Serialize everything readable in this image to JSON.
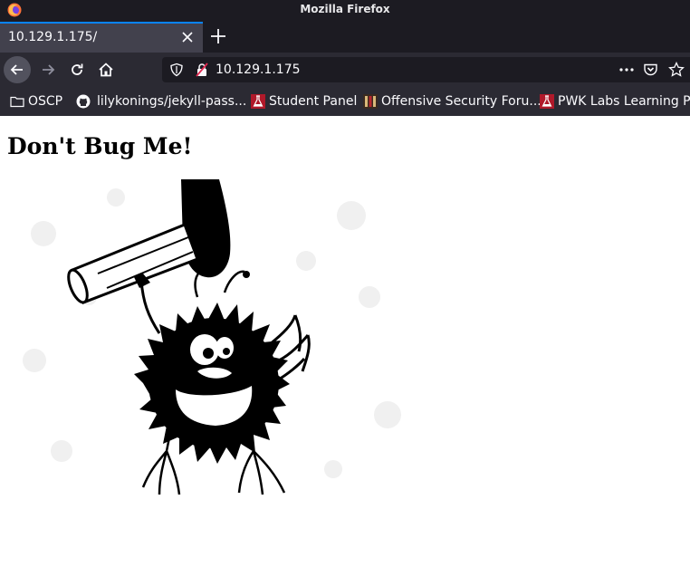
{
  "window": {
    "title": "Mozilla Firefox"
  },
  "tab": {
    "label": "10.129.1.175/"
  },
  "navbar": {
    "url": "10.129.1.175"
  },
  "bookmarks": [
    {
      "label": "OSCP",
      "icon": "folder-icon"
    },
    {
      "label": "lilykonings/jekyll-pass...",
      "icon": "github-icon"
    },
    {
      "label": "Student Panel",
      "icon": "flask-icon"
    },
    {
      "label": "Offensive Security Foru...",
      "icon": "forum-icon"
    },
    {
      "label": "PWK Labs Learning Pa",
      "icon": "flask-icon"
    }
  ],
  "page": {
    "heading": "Don't Bug Me!",
    "image": "bug-under-hammer-illustration"
  },
  "colors": {
    "titlebar": "#1c1b22",
    "toolbar": "#2b2a33",
    "tab_active": "#42414d",
    "accent": "#0a84ff"
  }
}
